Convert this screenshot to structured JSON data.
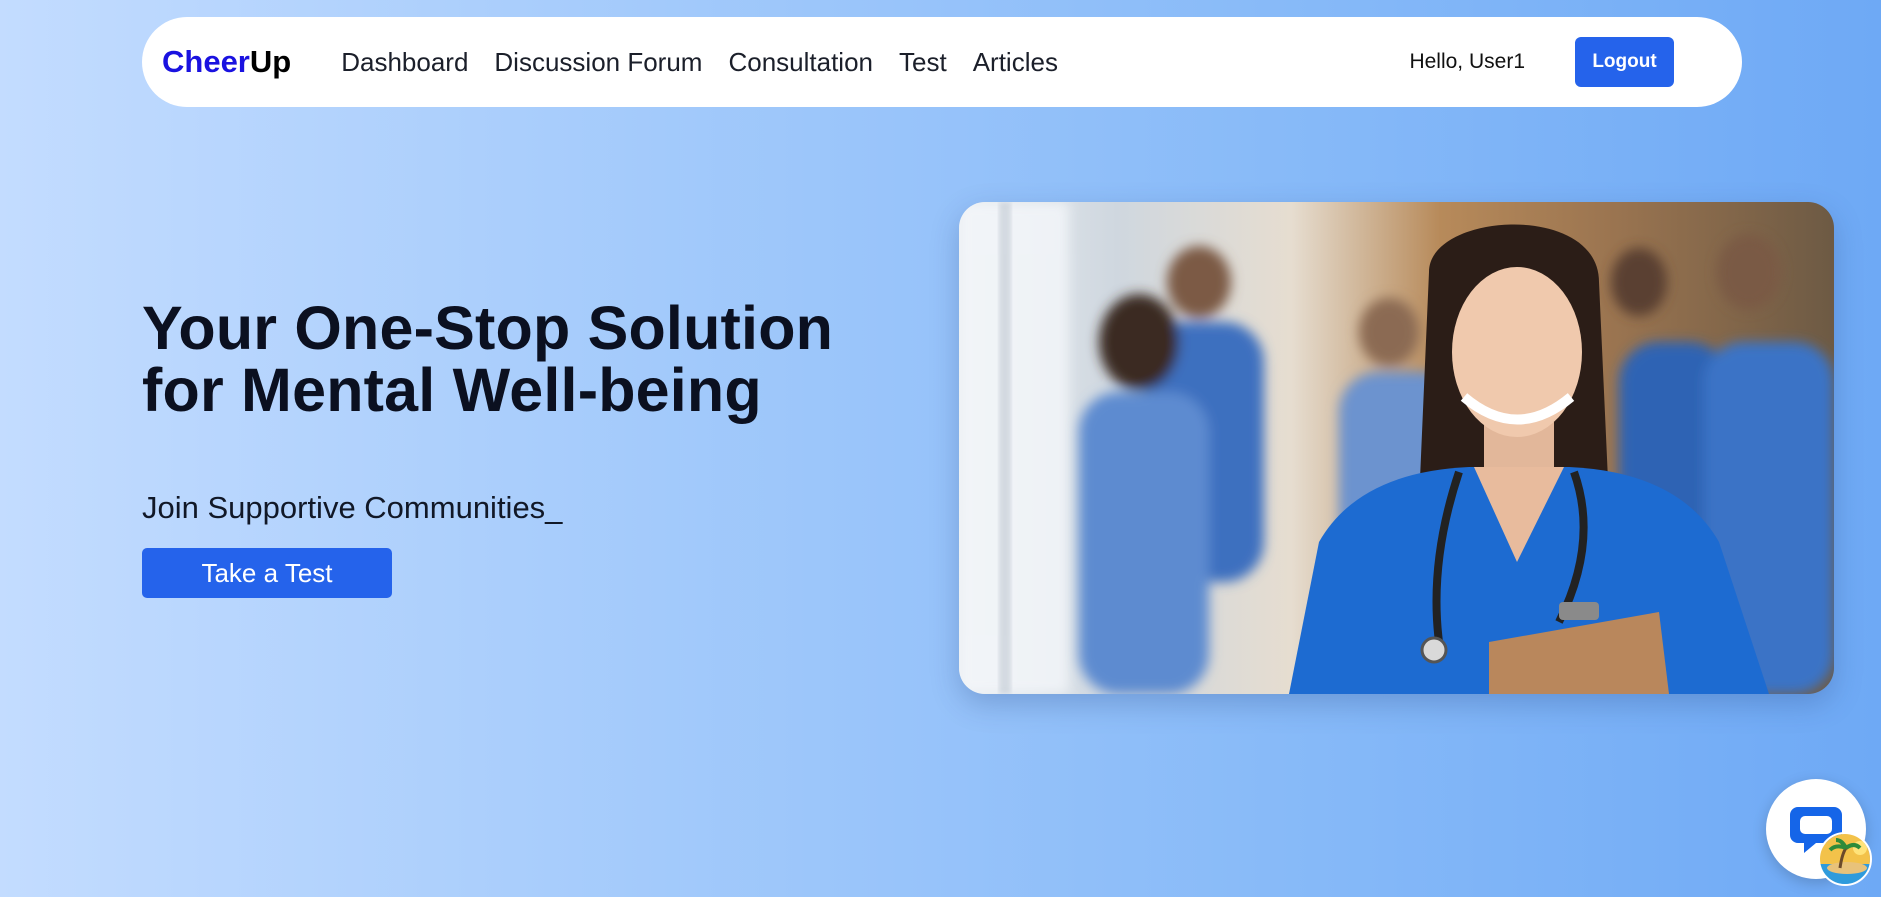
{
  "navbar": {
    "brand_part1": "Cheer",
    "brand_part2": "Up",
    "links": [
      "Dashboard",
      "Discussion Forum",
      "Consultation",
      "Test",
      "Articles"
    ],
    "greeting": "Hello, User1",
    "logout_label": "Logout"
  },
  "hero": {
    "title_line1": "Your One-Stop Solution",
    "title_line2": "for Mental Well-being",
    "subtitle": "Join Supportive Communities_",
    "cta_label": "Take a Test"
  },
  "icons": {
    "chat": "chat-bubble-icon",
    "badge": "island-avatar-icon"
  },
  "colors": {
    "brand_accent": "#1a12e0",
    "primary_button": "#2563eb",
    "chat_icon": "#1565e8"
  }
}
